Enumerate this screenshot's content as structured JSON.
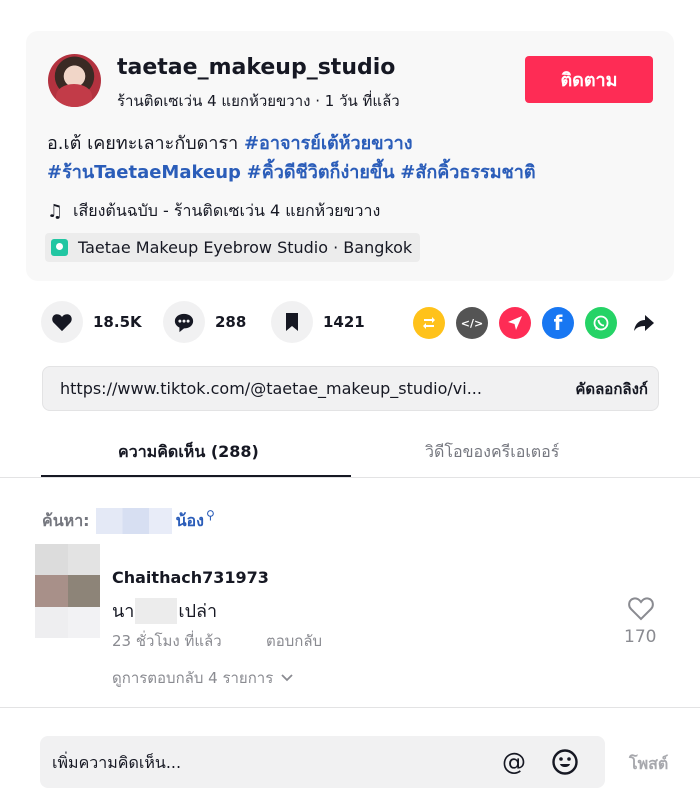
{
  "author": {
    "username": "taetae_makeup_studio",
    "subline": "ร้านติดเซเว่น 4 แยกห้วยขวาง · 1 วัน ที่แล้ว",
    "follow_label": "ติดตาม"
  },
  "description": {
    "text": "อ.เต้ เคยทะเลาะกับดารา",
    "hashtags": [
      "#อาจารย์เต้ห้วยขวาง",
      "#ร้านTaetaeMakeup",
      "#คิ้วดีชีวิตก็ง่ายขึ้น",
      "#สักคิ้วธรรมชาติ"
    ]
  },
  "music": {
    "label": "เสียงต้นฉบับ - ร้านติดเซเว่น 4 แยกห้วยขวาง"
  },
  "location": {
    "label": "Taetae Makeup Eyebrow Studio · Bangkok"
  },
  "stats": {
    "likes": "18.5K",
    "comments": "288",
    "saves": "1421"
  },
  "share_icons": [
    "repost-icon",
    "embed-icon",
    "send-icon",
    "facebook-icon",
    "whatsapp-icon",
    "share-arrow-icon"
  ],
  "link": {
    "url": "https://www.tiktok.com/@taetae_makeup_studio/vi...",
    "copy_label": "คัดลอกลิงก์"
  },
  "tabs": [
    {
      "label": "ความคิดเห็น (288)",
      "active": true
    },
    {
      "label": "วิดีโอของครีเอเตอร์",
      "active": false
    }
  ],
  "search": {
    "label": "ค้นหา:",
    "term": "น้อง"
  },
  "comments": [
    {
      "user": "Chaithach731973",
      "text_before": "นา",
      "text_after": "เปล่า",
      "time": "23 ชั่วโมง ที่แล้ว",
      "reply_label": "ตอบกลับ",
      "likes": "170",
      "view_replies": "ดูการตอบกลับ 4 รายการ"
    }
  ],
  "composer": {
    "placeholder": "เพิ่มความคิดเห็น...",
    "post_label": "โพสต์"
  },
  "colors": {
    "brand": "#fe2c55",
    "hashtag": "#2b5db9",
    "repost": "#ffc21a",
    "embed": "#545454",
    "send": "#fe2c55",
    "facebook": "#1877f2",
    "whatsapp": "#25d366"
  }
}
